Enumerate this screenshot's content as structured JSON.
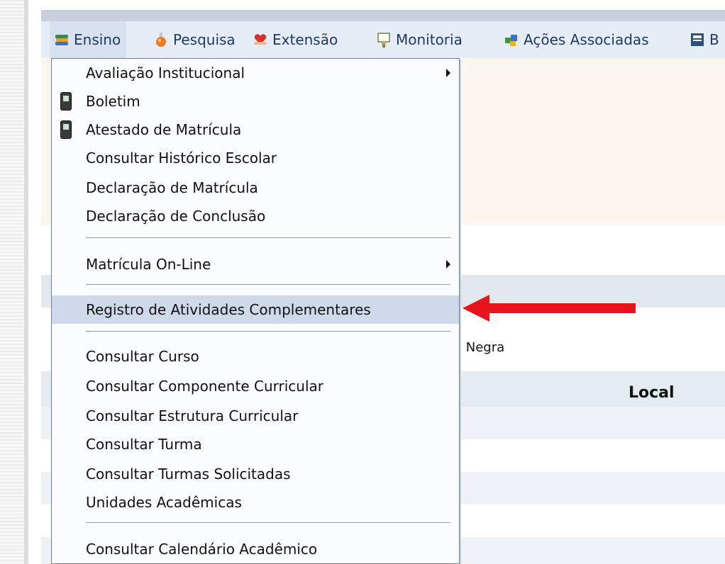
{
  "menubar": {
    "items": [
      {
        "label": "Ensino",
        "icon": "books-icon"
      },
      {
        "label": "Pesquisa",
        "icon": "flask-icon"
      },
      {
        "label": "Extensão",
        "icon": "heart-hands-icon"
      },
      {
        "label": "Monitoria",
        "icon": "teacher-icon"
      },
      {
        "label": "Ações Associadas",
        "icon": "puzzle-icon"
      },
      {
        "label": "B",
        "icon": "book-icon"
      }
    ]
  },
  "dropdown": {
    "items": [
      {
        "label": "Avaliação Institucional",
        "submenu": true,
        "icon": null
      },
      {
        "label": "Boletim",
        "submenu": false,
        "icon": "mobile-phone-icon"
      },
      {
        "label": "Atestado de Matrícula",
        "submenu": false,
        "icon": "mobile-phone-icon"
      },
      {
        "label": "Consultar Histórico Escolar",
        "submenu": false,
        "icon": null
      },
      {
        "label": "Declaração de Matrícula",
        "submenu": false,
        "icon": null
      },
      {
        "label": "Declaração de Conclusão",
        "submenu": false,
        "icon": null
      },
      {
        "label": "Matrícula On-Line",
        "submenu": true,
        "icon": null
      },
      {
        "label": "Registro de Atividades Complementares",
        "submenu": false,
        "icon": null,
        "highlighted": true
      },
      {
        "label": "Consultar Curso",
        "submenu": false,
        "icon": null
      },
      {
        "label": "Consultar Componente Curricular",
        "submenu": false,
        "icon": null
      },
      {
        "label": "Consultar Estrutura Curricular",
        "submenu": false,
        "icon": null
      },
      {
        "label": "Consultar Turma",
        "submenu": false,
        "icon": null
      },
      {
        "label": "Consultar Turmas Solicitadas",
        "submenu": false,
        "icon": null
      },
      {
        "label": "Unidades Acadêmicas",
        "submenu": false,
        "icon": null
      },
      {
        "label": "Consultar Calendário Acadêmico",
        "submenu": false,
        "icon": null
      }
    ]
  },
  "background": {
    "partial_text": "a Negra",
    "column_header": "Local"
  },
  "colors": {
    "arrow": "#e8141b",
    "highlight": "#cfd9ea",
    "menubar_text": "#1e3a66"
  }
}
